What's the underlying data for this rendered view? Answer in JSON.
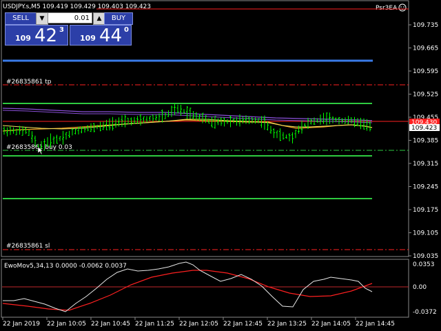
{
  "title_bar": {
    "text": "USDJPY.s,M5  109.419 109.429 109.403 109.423",
    "expert_label": "Psr3EA"
  },
  "trade_panel": {
    "sell_label": "SELL",
    "buy_label": "BUY",
    "lot_down": "▼",
    "lot_up": "▲",
    "lot_value": "0.01",
    "sell_price": {
      "prefix": "109",
      "big": "42",
      "sup": "3"
    },
    "buy_price": {
      "prefix": "109",
      "big": "44",
      "sup": "0"
    }
  },
  "price_axis": {
    "ticks": [
      "109.735",
      "109.665",
      "109.595",
      "109.525",
      "109.455",
      "109.385",
      "109.315",
      "109.245",
      "109.175",
      "109.105",
      "109.035"
    ],
    "bid_label": "109.423",
    "ask_label": "109.430"
  },
  "order_lines": {
    "tp": "#26835861 tp",
    "buy": "#26835861 buy 0.03",
    "sl": "#26835861 sl"
  },
  "indicator": {
    "label": "EwoMov5,34,13 0.0000 -0.0062 0.0037",
    "ticks": [
      "0.0353",
      "0.00",
      "-0.0372"
    ]
  },
  "time_axis": {
    "ticks": [
      "22 Jan 2019",
      "22 Jan 10:05",
      "22 Jan 10:45",
      "22 Jan 11:25",
      "22 Jan 12:05",
      "22 Jan 12:45",
      "22 Jan 13:25",
      "22 Jan 14:05",
      "22 Jan 14:45"
    ]
  },
  "colors": {
    "background": "#000000",
    "bull_bar": "#00ff00",
    "level_green": "#2ecc40",
    "blue_line": "#3a7be8",
    "red_line": "#ff2020",
    "ma_purple": "#8a4fd8",
    "ma_orange": "#f5a623",
    "ma_yellow": "#f0e060",
    "panel_blue": "#2c3fa8"
  }
}
